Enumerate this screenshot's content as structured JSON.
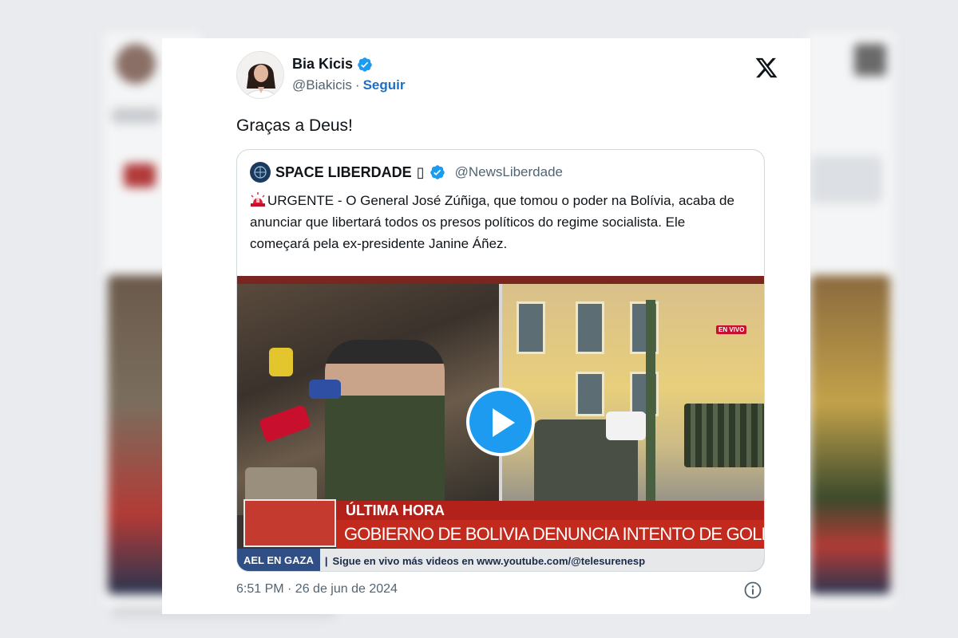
{
  "tweet": {
    "author_name": "Bia Kicis",
    "author_handle": "@Biakicis",
    "separator": "·",
    "follow_label": "Seguir",
    "text": "Graças a Deus!",
    "timestamp": "6:51 PM · 26 de jun de 2024"
  },
  "quoted_tweet": {
    "author_name": "SPACE LIBERDADE",
    "name_glyph": "▯",
    "author_handle": "@NewsLiberdade",
    "text": "URGENTE - O General José Zúñiga, que tomou o poder na Bolívia, acaba de anunciar que libertará todos os presos políticos do regime socialista. Ele começará pela ex-presidente Janine Áñez."
  },
  "video": {
    "live_badge": "EN VIVO",
    "lower_third_title": "ÚLTIMA HORA",
    "lower_third_headline": "GOBIERNO DE BOLIVIA DENUNCIA INTENTO DE GOLPE DE ESTADO",
    "ticker_left": "AEL EN GAZA",
    "ticker_sep": "|",
    "ticker_right": "Sigue en vivo más videos en www.youtube.com/@telesurenesp"
  },
  "colors": {
    "verified": "#1d9bf0",
    "follow": "#1d6fc4",
    "play_button": "#1d9bf0",
    "breaking_red": "#c22a1d"
  },
  "icons": [
    "verified-badge-icon",
    "x-logo-icon",
    "alarm-siren-icon",
    "play-icon",
    "info-icon"
  ]
}
